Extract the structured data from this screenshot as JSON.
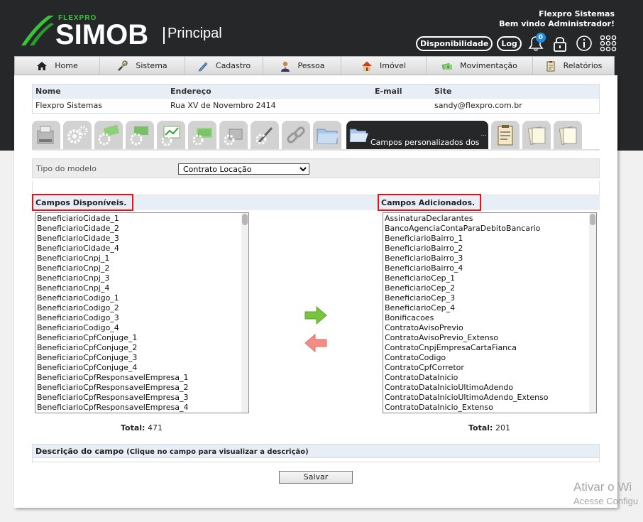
{
  "brand": {
    "small": "FLEXPRO",
    "name": "SIMOB",
    "section": "Principal"
  },
  "welcome": {
    "company": "Flexpro Sistemas",
    "greeting": "Bem vindo Administrador!"
  },
  "top_actions": {
    "availability": "Disponibilidade",
    "log": "Log",
    "notifications_count": "0"
  },
  "menu": [
    {
      "label": "Home",
      "icon": "home-icon"
    },
    {
      "label": "Sistema",
      "icon": "tools-icon"
    },
    {
      "label": "Cadastro",
      "icon": "pen-icon"
    },
    {
      "label": "Pessoa",
      "icon": "person-icon"
    },
    {
      "label": "Imóvel",
      "icon": "house-icon"
    },
    {
      "label": "Movimentação",
      "icon": "money-icon"
    },
    {
      "label": "Relatórios",
      "icon": "clipboard-icon"
    }
  ],
  "info": {
    "headers": {
      "name": "Nome",
      "address": "Endereço",
      "email": "E-mail",
      "site": "Site"
    },
    "row": {
      "name": "Flexpro Sistemas",
      "address": "Rua XV de Novembro 2414",
      "email": "",
      "site": "sandy@flexpro.com.br"
    }
  },
  "tabs": {
    "active_label": "Campos personalizados dos",
    "ellipsis": "..."
  },
  "filter": {
    "label": "Tipo do modelo",
    "selected": "Contrato Locação"
  },
  "available": {
    "title": "Campos Disponíveis.",
    "items": [
      "BeneficiarioCidade_1",
      "BeneficiarioCidade_2",
      "BeneficiarioCidade_3",
      "BeneficiarioCidade_4",
      "BeneficiarioCnpj_1",
      "BeneficiarioCnpj_2",
      "BeneficiarioCnpj_3",
      "BeneficiarioCnpj_4",
      "BeneficiarioCodigo_1",
      "BeneficiarioCodigo_2",
      "BeneficiarioCodigo_3",
      "BeneficiarioCodigo_4",
      "BeneficiarioCpfConjuge_1",
      "BeneficiarioCpfConjuge_2",
      "BeneficiarioCpfConjuge_3",
      "BeneficiarioCpfConjuge_4",
      "BeneficiarioCpfResponsavelEmpresa_1",
      "BeneficiarioCpfResponsavelEmpresa_2",
      "BeneficiarioCpfResponsavelEmpresa_3",
      "BeneficiarioCpfResponsavelEmpresa_4"
    ],
    "total_label": "Total:",
    "total": "471"
  },
  "added": {
    "title": "Campos Adicionados.",
    "items": [
      "AssinaturaDeclarantes",
      "BancoAgenciaContaParaDebitoBancario",
      "BeneficiarioBairro_1",
      "BeneficiarioBairro_2",
      "BeneficiarioBairro_3",
      "BeneficiarioBairro_4",
      "BeneficiarioCep_1",
      "BeneficiarioCep_2",
      "BeneficiarioCep_3",
      "BeneficiarioCep_4",
      "Bonificacoes",
      "ContratoAvisoPrevio",
      "ContratoAvisoPrevio_Extenso",
      "ContratoCnpjEmpresaCartaFianca",
      "ContratoCodigo",
      "ContratoCpfCorretor",
      "ContratoDataInicio",
      "ContratoDataInicioUltimoAdendo",
      "ContratoDataInicioUltimoAdendo_Extenso",
      "ContratoDataInicio_Extenso"
    ],
    "total_label": "Total:",
    "total": "201"
  },
  "description": {
    "title": "Descrição do campo",
    "hint": "(Clique no campo para visualizar a descrição)"
  },
  "save_label": "Salvar",
  "watermark": {
    "line1": "Ativar o Wi",
    "line2": "Acesse Configu"
  },
  "colors": {
    "dark": "#262729",
    "green": "#39c33a",
    "highlight": "#e0141b",
    "header": "#e8eef5"
  }
}
